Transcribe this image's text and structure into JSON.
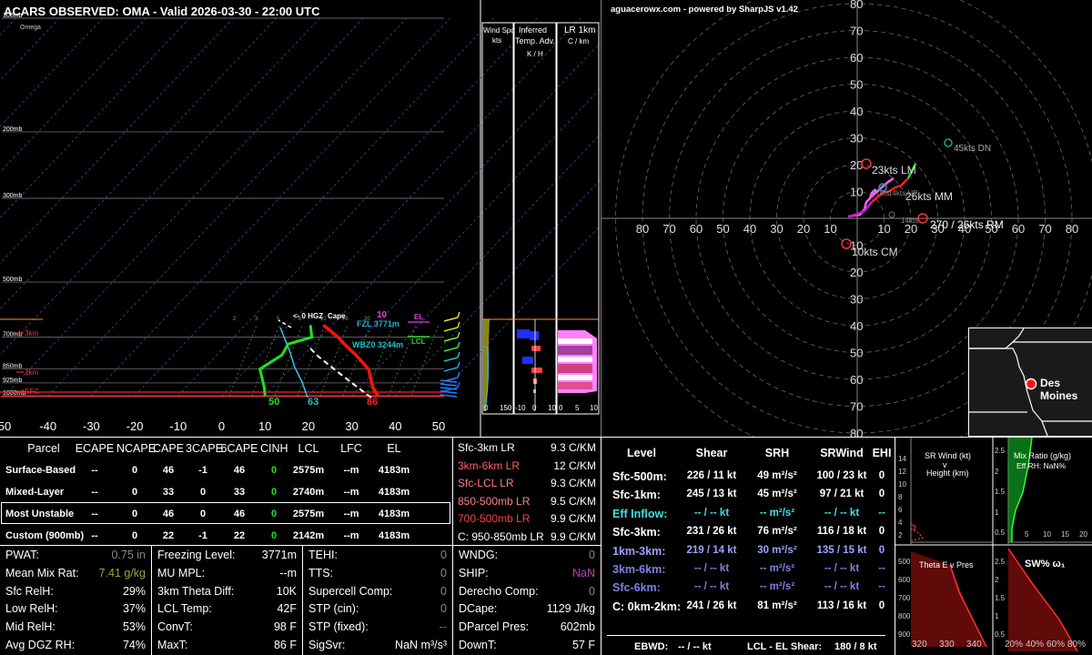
{
  "title": "ACARS OBSERVED: OMA - Valid 2026-03-30 - 22:00 UTC",
  "skewt": {
    "omega_label": "Omega",
    "pressure_labels": [
      {
        "p": 100,
        "label": "100mb"
      },
      {
        "p": 200,
        "label": "200mb"
      },
      {
        "p": 300,
        "label": "300mb"
      },
      {
        "p": 500,
        "label": "500mb"
      },
      {
        "p": 700,
        "label": "700mb"
      },
      {
        "p": 850,
        "label": "850mb"
      },
      {
        "p": 925,
        "label": "925mb"
      },
      {
        "p": 1000,
        "label": "1000mb"
      }
    ],
    "height_labels": [
      "3km",
      "1km",
      "SFC"
    ],
    "x_ticks": [
      "50",
      "-40",
      "-30",
      "-20",
      "-10",
      "0",
      "10",
      "20",
      "30",
      "40",
      "50"
    ],
    "annotations": {
      "hgz": "<- 0 HGZ",
      "cape_top": "Cape",
      "fzl": "FZL 3771m",
      "wbz": "WBZ0 3244m",
      "el": "EL",
      "lcl": "LCL",
      "lfc_value": "10"
    },
    "surface_values": {
      "dewpoint": "50",
      "wetbulb": "63",
      "temperature": "86"
    },
    "mixing_ratio_labels": [
      "2",
      "3",
      "5",
      "8",
      "12",
      "16",
      "20"
    ]
  },
  "wind_panel": {
    "title1": "Wind Spd",
    "title2": "kts",
    "ticks": [
      "0",
      "150"
    ],
    "color": "#c0c020"
  },
  "temp_adv_panel": {
    "title1": "Inferred",
    "title2": "Temp. Adv.",
    "title3": "K / H",
    "ticks": [
      "-10",
      "0",
      "10"
    ]
  },
  "lr_panel": {
    "title1": "LR 1km",
    "title2": "C / km",
    "ticks": [
      "0",
      "5",
      "10"
    ]
  },
  "hodograph": {
    "credit": "aguacerowx.com - powered by SharpJS v1.42",
    "axis_labels": [
      "10",
      "20",
      "30",
      "40",
      "50",
      "60",
      "70",
      "80"
    ],
    "annotations": {
      "lm": "23kts LM",
      "mm": "26kts MM",
      "rm": "270 / 26kts RM",
      "cm": "10kts CM",
      "dn": "45kts DN",
      "up": "14kts UP",
      "inner1": "17kts",
      "inner2": "14kts"
    }
  },
  "map": {
    "city": "Des Moines"
  },
  "parcel_table": {
    "headers": [
      "Parcel",
      "ECAPE",
      "NCAPE",
      "CAPE",
      "3CAPE",
      "6CAPE",
      "CINH",
      "LCL",
      "LFC",
      "EL"
    ],
    "rows": [
      [
        "Surface-Based",
        "--",
        "0",
        "46",
        "-1",
        "46",
        "0",
        "2575m",
        "--m",
        "4183m"
      ],
      [
        "Mixed-Layer",
        "--",
        "0",
        "33",
        "0",
        "33",
        "0",
        "2740m",
        "--m",
        "4183m"
      ],
      [
        "Most Unstable",
        "--",
        "0",
        "46",
        "0",
        "46",
        "0",
        "2575m",
        "--m",
        "4183m"
      ],
      [
        "Custom (900mb)",
        "--",
        "0",
        "22",
        "-1",
        "22",
        "0",
        "2142m",
        "--m",
        "4183m"
      ]
    ]
  },
  "lapse_rates": [
    {
      "label": "Sfc-3km LR",
      "value": "9.3 C/KM",
      "color": "#ffffff"
    },
    {
      "label": "3km-6km LR",
      "value": "12 C/KM",
      "color": "#ff6060"
    },
    {
      "label": "Sfc-LCL LR",
      "value": "9.3 C/KM",
      "color": "#ff8080"
    },
    {
      "label": "850-500mb LR",
      "value": "9.5 C/KM",
      "color": "#ff8080"
    },
    {
      "label": "700-500mb LR",
      "value": "9.9 C/KM",
      "color": "#ff4040"
    },
    {
      "label": "C: 950-850mb LR",
      "value": "9.9 C/KM",
      "color": "#ffffff"
    }
  ],
  "thermo_left": [
    {
      "label": "PWAT:",
      "value": "0.75 in",
      "color": "#888888"
    },
    {
      "label": "Mean Mix Rat:",
      "value": "7.41 g/kg",
      "color": "#a0a040"
    },
    {
      "label": "Sfc RelH:",
      "value": "29%",
      "color": "#ffffff"
    },
    {
      "label": "Low RelH:",
      "value": "37%",
      "color": "#ffffff"
    },
    {
      "label": "Mid RelH:",
      "value": "53%",
      "color": "#ffffff"
    },
    {
      "label": "Avg DGZ RH:",
      "value": "74%",
      "color": "#ffffff"
    }
  ],
  "thermo_mid": [
    {
      "label": "Freezing Level:",
      "value": "3771m"
    },
    {
      "label": "MU MPL:",
      "value": "--m"
    },
    {
      "label": "3km Theta Diff:",
      "value": "10K"
    },
    {
      "label": "LCL Temp:",
      "value": "42F"
    },
    {
      "label": "ConvT:",
      "value": "98 F"
    },
    {
      "label": "MaxT:",
      "value": "86 F"
    }
  ],
  "thermo_idx": [
    {
      "label": "TEHI:",
      "value": "0",
      "color": "#888888"
    },
    {
      "label": "TTS:",
      "value": "0",
      "color": "#888888"
    },
    {
      "label": "Supercell Comp:",
      "value": "0",
      "color": "#888888"
    },
    {
      "label": "STP (cin):",
      "value": "0",
      "color": "#888888"
    },
    {
      "label": "STP (fixed):",
      "value": "--",
      "color": "#c040c0"
    },
    {
      "label": "SigSvr:",
      "value": "NaN m³/s³",
      "color": "#ffffff"
    }
  ],
  "thermo_right": [
    {
      "label": "WNDG:",
      "value": "0",
      "color": "#888888"
    },
    {
      "label": "SHIP:",
      "value": "NaN",
      "color": "#c040c0"
    },
    {
      "label": "Derecho Comp:",
      "value": "0",
      "color": "#888888"
    },
    {
      "label": "DCape:",
      "value": "1129 J/kg",
      "color": "#ffffff"
    },
    {
      "label": "DParcel Pres:",
      "value": "602mb",
      "color": "#ffffff"
    },
    {
      "label": "DownT:",
      "value": "57 F",
      "color": "#ffffff"
    }
  ],
  "kinematics": {
    "headers": [
      "Level",
      "Shear",
      "SRH",
      "SRWind",
      "EHI"
    ],
    "rows": [
      {
        "label": "Sfc-500m:",
        "shear": "226 / 11 kt",
        "srh": "49 m²/s²",
        "srw": "100 / 23 kt",
        "ehi": "0",
        "color": "#ffffff"
      },
      {
        "label": "Sfc-1km:",
        "shear": "245 / 13 kt",
        "srh": "45 m²/s²",
        "srw": "97 / 21 kt",
        "ehi": "0",
        "color": "#ffffff"
      },
      {
        "label": "Eff Inflow:",
        "shear": "-- / -- kt",
        "srh": "-- m²/s²",
        "srw": "-- / -- kt",
        "ehi": "--",
        "color": "#40e0e0"
      },
      {
        "label": "Sfc-3km:",
        "shear": "231 / 26 kt",
        "srh": "76 m²/s²",
        "srw": "116 / 18 kt",
        "ehi": "0",
        "color": "#ffffff"
      },
      {
        "label": "1km-3km:",
        "shear": "219 / 14 kt",
        "srh": "30 m²/s²",
        "srw": "135 / 15 kt",
        "ehi": "0",
        "color": "#a0a0ff"
      },
      {
        "label": "3km-6km:",
        "shear": "-- / -- kt",
        "srh": "-- m²/s²",
        "srw": "-- / -- kt",
        "ehi": "--",
        "color": "#8080e0"
      },
      {
        "label": "Sfc-6km:",
        "shear": "-- / -- kt",
        "srh": "-- m²/s²",
        "srw": "-- / -- kt",
        "ehi": "--",
        "color": "#8080e0"
      },
      {
        "label": "C: 0km-2km:",
        "shear": "241 / 26 kt",
        "srh": "81 m²/s²",
        "srw": "113 / 16 kt",
        "ehi": "0",
        "color": "#ffffff"
      }
    ],
    "ebwd_label": "EBWD:",
    "ebwd_value": "-- / -- kt",
    "lcl_el_label": "LCL - EL Shear:",
    "lcl_el_value": "180 / 8 kt"
  },
  "mini_srwind": {
    "title1": "SR Wind (kt)",
    "title2": "v",
    "title3": "Height (km)",
    "y_ticks": [
      "14",
      "12",
      "10",
      "8",
      "6",
      "4",
      "2"
    ]
  },
  "mini_mixratio": {
    "title1": "Mix Ratio (g/kg)",
    "title2": "Eff RH: NaN%",
    "y_ticks": [
      "2.5",
      "2",
      "1.5",
      "1",
      "0.5"
    ],
    "x_ticks": [
      "5",
      "10",
      "15",
      "20"
    ]
  },
  "mini_thetae": {
    "title": "Theta E v Pres",
    "y_ticks": [
      "500",
      "600",
      "700",
      "800",
      "900"
    ],
    "x_ticks": [
      "320",
      "330",
      "340"
    ]
  },
  "mini_sw": {
    "title": "SW% ω₁",
    "y_ticks": [
      "2.5",
      "2",
      "1.5",
      "1",
      "0.5"
    ],
    "x_ticks": [
      "20%",
      "40%",
      "60%",
      "80%"
    ]
  },
  "chart_data": {
    "type": "line",
    "series": [
      {
        "name": "temperature",
        "points": [
          [
            36,
            1000
          ],
          [
            33,
            950
          ],
          [
            28,
            850
          ],
          [
            22,
            780
          ],
          [
            17,
            730
          ],
          [
            14,
            700
          ],
          [
            8,
            650
          ]
        ]
      },
      {
        "name": "dewpoint",
        "points": [
          [
            10,
            1000
          ],
          [
            8,
            950
          ],
          [
            3,
            850
          ],
          [
            5,
            780
          ],
          [
            4,
            730
          ],
          [
            8,
            700
          ],
          [
            5,
            650
          ]
        ]
      }
    ],
    "xlim": [
      -50,
      50
    ],
    "ylim": [
      1000,
      100
    ]
  }
}
